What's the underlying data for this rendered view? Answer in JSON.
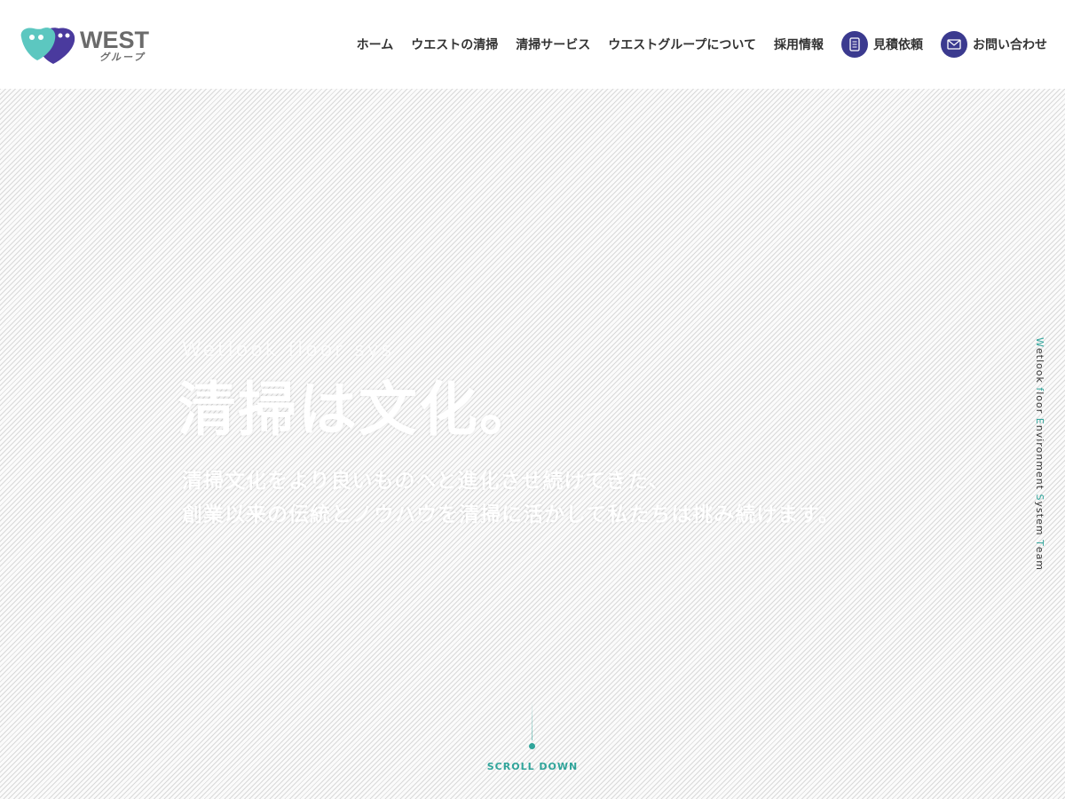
{
  "logo": {
    "word": "WEST",
    "sub": "グループ"
  },
  "nav": [
    {
      "label": "ホーム"
    },
    {
      "label": "ウエストの清掃"
    },
    {
      "label": "清掃サービス"
    },
    {
      "label": "ウエストグループについて"
    },
    {
      "label": "採用情報"
    },
    {
      "label": "見積依頼",
      "icon": "document-icon"
    },
    {
      "label": "お問い合わせ",
      "icon": "mail-icon"
    }
  ],
  "hero": {
    "catch": "Wetlook floor sys",
    "title": "清掃は文化。",
    "line1": "清掃文化をより良いものへと進化させ続けてきた、",
    "line2": "創業以来の伝統とノウハウを清掃に活かして私たちは挑み続けます。"
  },
  "vertical_tag": {
    "w": "W",
    "w_rest": "etlook ",
    "f": "f",
    "f_rest": "loor ",
    "e": "E",
    "e_rest": "nvironment ",
    "s": "S",
    "s_rest": "ystem ",
    "t": "T",
    "t_rest": "eam"
  },
  "scroll": {
    "label": "SCROLL DOWN"
  },
  "colors": {
    "accent": "#2fa49a",
    "brand_purple": "#3b3a8f",
    "logo_teal": "#5cc7c0"
  }
}
